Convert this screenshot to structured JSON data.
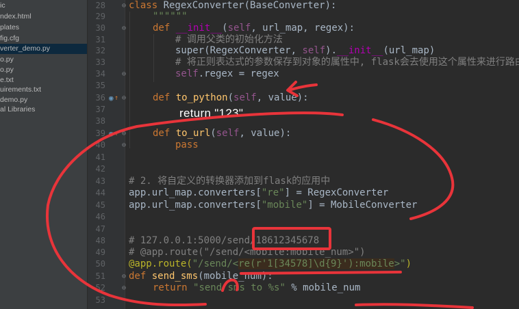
{
  "sidebar": {
    "items": [
      {
        "label": "ic",
        "selected": false
      },
      {
        "label": "ndex.html",
        "selected": false
      },
      {
        "label": "plates",
        "selected": false
      },
      {
        "label": "fig.cfg",
        "selected": false
      },
      {
        "label": "verter_demo.py",
        "selected": true
      },
      {
        "label": "o.py",
        "selected": false
      },
      {
        "label": "o.py",
        "selected": false
      },
      {
        "label": "e.txt",
        "selected": false
      },
      {
        "label": "uirements.txt",
        "selected": false
      },
      {
        "label": "demo.py",
        "selected": false
      },
      {
        "label": "al Libraries",
        "selected": false
      }
    ]
  },
  "editor": {
    "line_numbers": [
      "28",
      "29",
      "30",
      "31",
      "32",
      "33",
      "34",
      "35",
      "36",
      "37",
      "38",
      "39",
      "40",
      "41",
      "42",
      "43",
      "44",
      "45",
      "46",
      "47",
      "48",
      "49",
      "50",
      "51",
      "52",
      "53"
    ],
    "code": {
      "l28_kw": "class ",
      "l28_rest": "RegexConverter(BaseConverter):",
      "l29": "\"\"\"\"\"\"",
      "l30_kw": "def ",
      "l30_fn": "__init__",
      "l30_open": "(",
      "l30_self": "self",
      "l30_rest": ", url_map, regex):",
      "l31": "# 调用父类的初始化方法",
      "l32_a": "super(RegexConverter, ",
      "l32_self": "self",
      "l32_b": ").",
      "l32_init": "__init__",
      "l32_c": "(url_map)",
      "l33": "# 将正则表达式的参数保存到对象的属性中, flask会去使用这个属性来进行路由",
      "l34_self": "self",
      "l34_rest": ".regex = regex",
      "l36_kw": "def ",
      "l36_fn": "to_python",
      "l36_open": "(",
      "l36_self": "self",
      "l36_rest": ", value):",
      "l39_kw": "def ",
      "l39_fn": "to_url",
      "l39_open": "(",
      "l39_self": "self",
      "l39_rest": ", value):",
      "l40": "pass",
      "l43": "# 2. 将自定义的转换器添加到flask的应用中",
      "l44_a": "app.url_map.converters[",
      "l44_str": "\"re\"",
      "l44_b": "] = RegexConverter",
      "l45_a": "app.url_map.converters[",
      "l45_str": "\"mobile\"",
      "l45_b": "] = MobileConverter",
      "l48_a": "# 127.0.0.1:5000/send/",
      "l48_b": "18612345678",
      "l49": "# @app.route(\"/send/<mobile:mobile_num>\")",
      "l50_dec": "@app.route(",
      "l50_str1": "\"/send/<",
      "l50_inj": "re(r'1[34578]\\d{9}'):mobile",
      "l50_str2": ">\"",
      "l50_close": ")",
      "l51_kw": "def ",
      "l51_fn": "send_sms",
      "l51_rest": "(mobile_num):",
      "l52_kw": "return ",
      "l52_str": "\"send sms to %s\"",
      "l52_rest": " % mobile_num"
    }
  },
  "annotations": {
    "handwritten_text": "return  \"123\"",
    "ink_color": "#e8343a"
  },
  "colors": {
    "keyword": "#cc7832",
    "function": "#ffc66d",
    "string": "#6a8759",
    "comment": "#808080",
    "self": "#94558d",
    "decorator": "#bbb529",
    "default_text": "#a9b7c6",
    "background": "#2b2b2b"
  }
}
